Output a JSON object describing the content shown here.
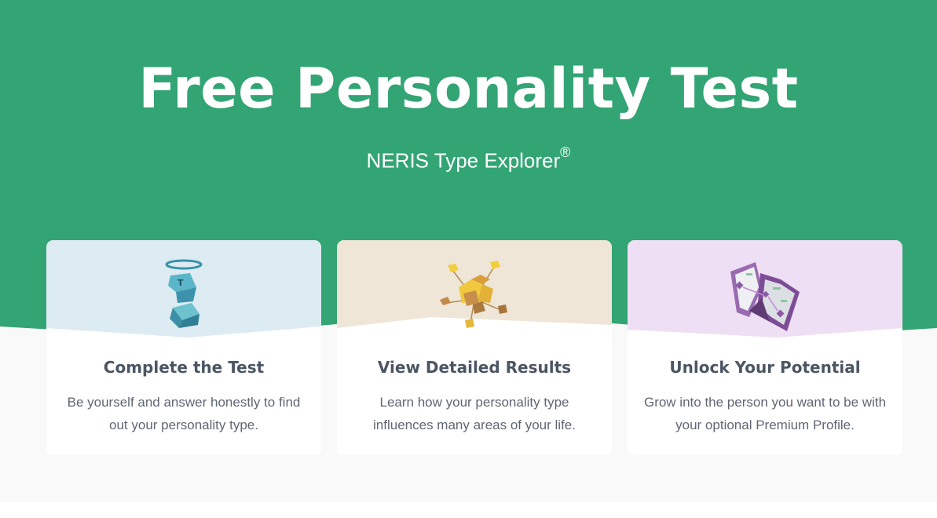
{
  "hero": {
    "title": "Free Personality Test",
    "subtitle": "NERIS Type Explorer",
    "subtitle_mark": "®"
  },
  "colors": {
    "hero_green": "#33a474",
    "section_bg": "#f9f9f9",
    "card1_top": "#ddebf2",
    "card2_top": "#efe6d8",
    "card3_top": "#efdff5"
  },
  "cards": [
    {
      "icon": "haloed-cubes-icon",
      "title": "Complete the Test",
      "text": "Be yourself and answer honestly to find out your personality type."
    },
    {
      "icon": "cube-network-icon",
      "title": "View Detailed Results",
      "text": "Learn how your personality type influences many areas of your life."
    },
    {
      "icon": "profile-map-icon",
      "title": "Unlock Your Potential",
      "text": "Grow into the person you want to be with your optional Premium Profile."
    }
  ]
}
